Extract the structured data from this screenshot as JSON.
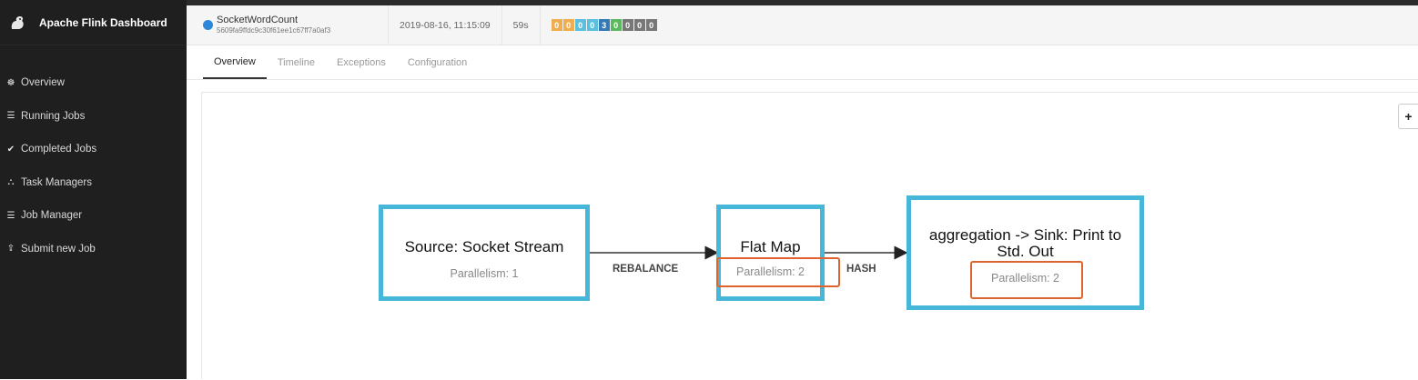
{
  "app": {
    "title": "Apache Flink Dashboard",
    "logo_icon": "squirrel-icon"
  },
  "sidebar": {
    "items": [
      {
        "label": "Overview",
        "icon": "dashboard-icon"
      },
      {
        "label": "Running Jobs",
        "icon": "list-icon"
      },
      {
        "label": "Completed Jobs",
        "icon": "check-circle-icon"
      },
      {
        "label": "Task Managers",
        "icon": "sitemap-icon"
      },
      {
        "label": "Job Manager",
        "icon": "list-icon"
      },
      {
        "label": "Submit new Job",
        "icon": "upload-icon"
      }
    ]
  },
  "job": {
    "name": "SocketWordCount",
    "id": "5609fa9ffdc9c30f61ee1c67ff7a0af3",
    "start_time": "2019-08-16, 11:15:09",
    "duration": "59s",
    "status_color": "#2d86d9",
    "task_counts": [
      {
        "value": "0",
        "color": "#f0ad4e"
      },
      {
        "value": "0",
        "color": "#f0ad4e"
      },
      {
        "value": "0",
        "color": "#5bc0de"
      },
      {
        "value": "0",
        "color": "#5bc0de"
      },
      {
        "value": "3",
        "color": "#337ab7"
      },
      {
        "value": "0",
        "color": "#5cb85c"
      },
      {
        "value": "0",
        "color": "#777777"
      },
      {
        "value": "0",
        "color": "#777777"
      },
      {
        "value": "0",
        "color": "#777777"
      }
    ]
  },
  "tabs": [
    "Overview",
    "Timeline",
    "Exceptions",
    "Configuration"
  ],
  "plan": {
    "nodes": [
      {
        "title": "Source: Socket Stream",
        "parallelism": "Parallelism: 1"
      },
      {
        "title": "Flat Map",
        "parallelism": "Parallelism: 2"
      },
      {
        "title": "aggregation -> Sink: Print to Std. Out",
        "parallelism": "Parallelism: 2"
      }
    ],
    "edges": [
      "REBALANCE",
      "HASH"
    ],
    "node_border_color": "#47b7d9",
    "highlight_color": "#e0622d"
  },
  "zoom_in_label": "+"
}
